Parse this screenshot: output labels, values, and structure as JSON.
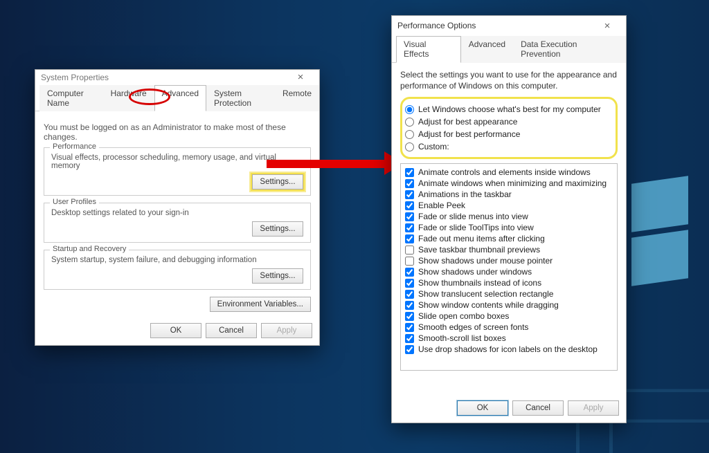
{
  "sysprops": {
    "title": "System Properties",
    "tabs": [
      "Computer Name",
      "Hardware",
      "Advanced",
      "System Protection",
      "Remote"
    ],
    "active_tab": 2,
    "admin_note": "You must be logged on as an Administrator to make most of these changes.",
    "groups": {
      "performance": {
        "label": "Performance",
        "desc": "Visual effects, processor scheduling, memory usage, and virtual memory",
        "button": "Settings..."
      },
      "user_profiles": {
        "label": "User Profiles",
        "desc": "Desktop settings related to your sign-in",
        "button": "Settings..."
      },
      "startup": {
        "label": "Startup and Recovery",
        "desc": "System startup, system failure, and debugging information",
        "button": "Settings..."
      }
    },
    "env_button": "Environment Variables...",
    "bottom": {
      "ok": "OK",
      "cancel": "Cancel",
      "apply": "Apply"
    }
  },
  "perf": {
    "title": "Performance Options",
    "tabs": [
      "Visual Effects",
      "Advanced",
      "Data Execution Prevention"
    ],
    "active_tab": 0,
    "explain": "Select the settings you want to use for the appearance and performance of Windows on this computer.",
    "radios": [
      {
        "label": "Let Windows choose what's best for my computer",
        "checked": true
      },
      {
        "label": "Adjust for best appearance",
        "checked": false
      },
      {
        "label": "Adjust for best performance",
        "checked": false
      },
      {
        "label": "Custom:",
        "checked": false
      }
    ],
    "checks": [
      {
        "label": "Animate controls and elements inside windows",
        "checked": true
      },
      {
        "label": "Animate windows when minimizing and maximizing",
        "checked": true
      },
      {
        "label": "Animations in the taskbar",
        "checked": true
      },
      {
        "label": "Enable Peek",
        "checked": true
      },
      {
        "label": "Fade or slide menus into view",
        "checked": true
      },
      {
        "label": "Fade or slide ToolTips into view",
        "checked": true
      },
      {
        "label": "Fade out menu items after clicking",
        "checked": true
      },
      {
        "label": "Save taskbar thumbnail previews",
        "checked": false
      },
      {
        "label": "Show shadows under mouse pointer",
        "checked": false
      },
      {
        "label": "Show shadows under windows",
        "checked": true
      },
      {
        "label": "Show thumbnails instead of icons",
        "checked": true
      },
      {
        "label": "Show translucent selection rectangle",
        "checked": true
      },
      {
        "label": "Show window contents while dragging",
        "checked": true
      },
      {
        "label": "Slide open combo boxes",
        "checked": true
      },
      {
        "label": "Smooth edges of screen fonts",
        "checked": true
      },
      {
        "label": "Smooth-scroll list boxes",
        "checked": true
      },
      {
        "label": "Use drop shadows for icon labels on the desktop",
        "checked": true
      }
    ],
    "bottom": {
      "ok": "OK",
      "cancel": "Cancel",
      "apply": "Apply"
    }
  }
}
